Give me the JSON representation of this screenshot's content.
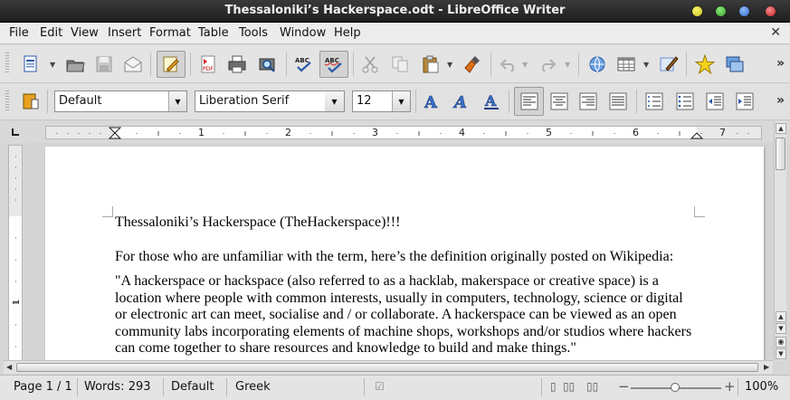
{
  "window": {
    "title": "Thessaloniki’s Hackerspace.odt - LibreOffice Writer"
  },
  "menubar": {
    "items": [
      "File",
      "Edit",
      "View",
      "Insert",
      "Format",
      "Table",
      "Tools",
      "Window",
      "Help"
    ],
    "close_glyph": "✕"
  },
  "toolbar_standard": {
    "icons": [
      "new-document-icon",
      "open-icon",
      "save-icon",
      "email-icon",
      "edit-mode-icon",
      "export-pdf-icon",
      "print-icon",
      "print-preview-icon",
      "spellcheck-icon",
      "autospellcheck-icon",
      "cut-icon",
      "copy-icon",
      "paste-icon",
      "clone-formatting-icon",
      "undo-icon",
      "redo-icon",
      "hyperlink-icon",
      "table-icon",
      "show-draw-functions-icon",
      "navigator-icon",
      "gallery-icon"
    ],
    "overflow": "»"
  },
  "toolbar_formatting": {
    "paragraph_style": "Default",
    "font_name": "Liberation Serif",
    "font_size": "12",
    "overflow": "»"
  },
  "ruler": {
    "numbers": [
      "1",
      "2",
      "3",
      "4",
      "5",
      "6",
      "7"
    ]
  },
  "document": {
    "heading": "Thessaloniki’s Hackerspace (TheHackerspace)!!!",
    "intro": "For those who are unfamiliar with the term, here’s the definition originally posted on Wikipedia:",
    "quote_lines": [
      "\"A hackerspace or hackspace (also referred to as a hacklab, makerspace or creative space) is a",
      "location where people with common interests, usually in computers, technology, science or digital",
      "or electronic art can meet, socialise and / or collaborate. A hackerspace can be viewed as an open",
      "community labs incorporating elements of machine shops, workshops and/or studios where hackers",
      "can come together to share resources and knowledge to build and make things.\""
    ]
  },
  "statusbar": {
    "page": "Page 1 / 1",
    "words": "Words: 293",
    "page_style": "Default",
    "language": "Greek",
    "zoom_minus": "−",
    "zoom_plus": "+",
    "zoom": "100%"
  }
}
